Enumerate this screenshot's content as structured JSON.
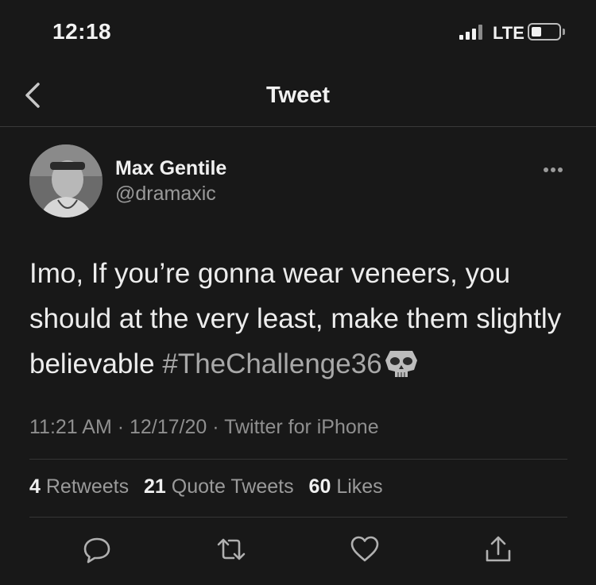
{
  "status_bar": {
    "time": "12:18",
    "network": "LTE"
  },
  "nav": {
    "title": "Tweet",
    "back_icon": "chevron-left-icon"
  },
  "tweet": {
    "author_name": "Max Gentile",
    "author_handle": "@dramaxic",
    "text_main": "Imo, If you’re gonna wear veneers, you should at the very least, make them slightly believable ",
    "hashtag": "#TheChallenge36",
    "emoji_icon": "skull-icon",
    "meta": "11:21 AM · 12/17/20 · Twitter for iPhone",
    "stats": {
      "retweets_count": "4",
      "retweets_label": "Retweets",
      "quote_count": "21",
      "quote_label": "Quote Tweets",
      "likes_count": "60",
      "likes_label": "Likes"
    }
  },
  "actions": [
    "reply-icon",
    "retweet-icon",
    "like-icon",
    "share-icon"
  ],
  "colors": {
    "background": "#181818",
    "text": "#ececec",
    "secondary_text": "#9a9a9a",
    "divider": "#353535"
  }
}
